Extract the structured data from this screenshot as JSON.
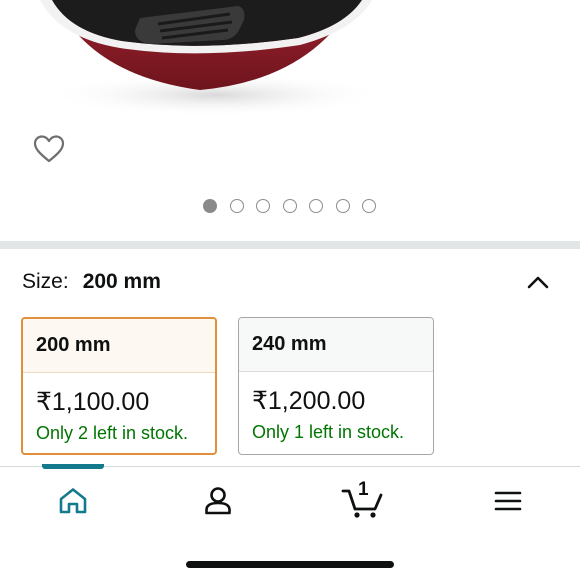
{
  "product_image": {
    "icon": "frying-pan-image",
    "total_images": 7,
    "active_index": 0
  },
  "wishlist": {
    "icon": "heart-icon"
  },
  "size_selector": {
    "label": "Size:",
    "selected_value": "200 mm",
    "collapse_icon": "chevron-up-icon",
    "options": [
      {
        "name": "200 mm",
        "price": "₹1,100.00",
        "stock": "Only 2 left in stock.",
        "selected": true
      },
      {
        "name": "240 mm",
        "price": "₹1,200.00",
        "stock": "Only 1 left in stock.",
        "selected": false
      }
    ]
  },
  "bottom_nav": {
    "items": [
      {
        "name": "home",
        "icon": "home-icon",
        "active": true
      },
      {
        "name": "account",
        "icon": "user-icon",
        "active": false
      },
      {
        "name": "cart",
        "icon": "cart-icon",
        "active": false
      },
      {
        "name": "menu",
        "icon": "hamburger-menu-icon",
        "active": false
      }
    ],
    "cart_count": "1"
  },
  "colors": {
    "accent": "#127a8c",
    "selected_border": "#e08f3a",
    "stock_green": "#007600",
    "pan_red": "#8b1a24"
  }
}
